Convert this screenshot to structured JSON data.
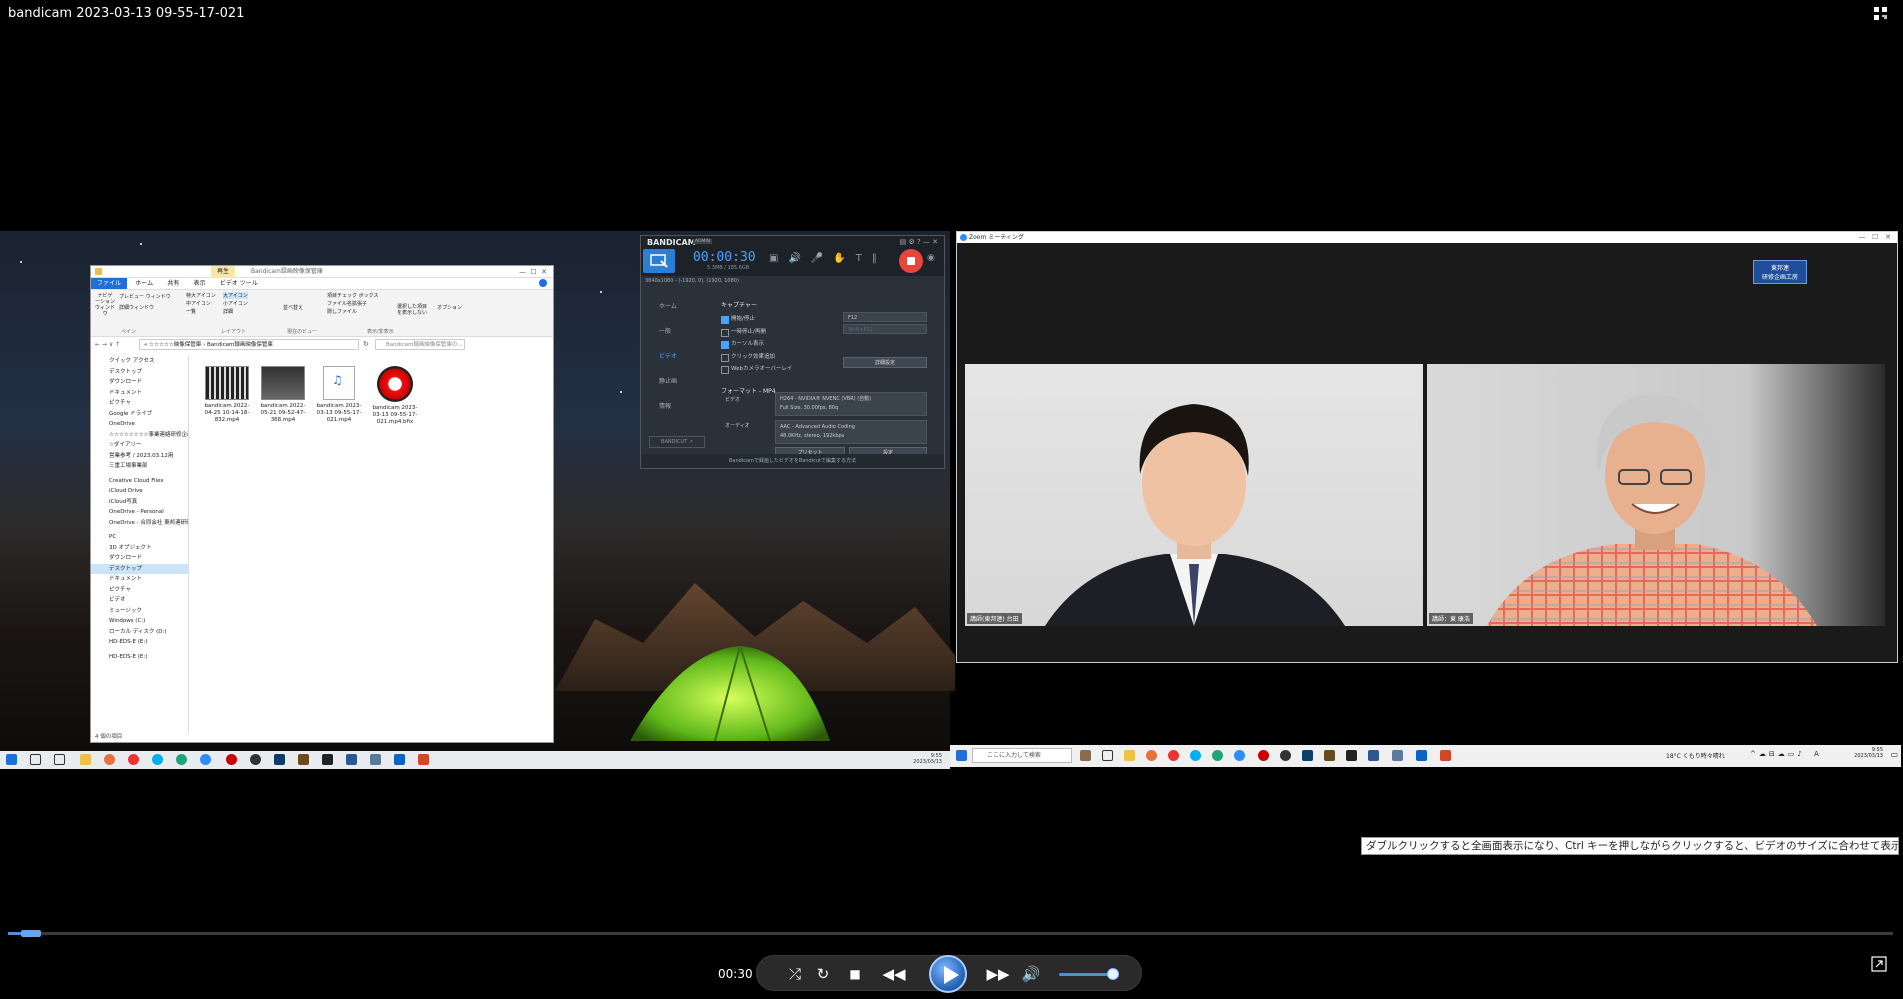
{
  "window": {
    "title": "bandicam 2023-03-13 09-55-17-021"
  },
  "player": {
    "current_time": "00:30",
    "progress_fraction": 0.012,
    "volume_fraction": 0.9,
    "tooltip": "ダブルクリックすると全画面表示になり、Ctrl キーを押しながらクリックすると、ビデオのサイズに合わせて表示されます。"
  },
  "explorer": {
    "title": "Bandicam録画映像保管庫",
    "context_tab": "再生",
    "ribbon_tabs": [
      "ファイル",
      "ホーム",
      "共有",
      "表示",
      "ビデオ ツール"
    ],
    "ribbon_groups": [
      "ペイン",
      "レイアウト",
      "現在のビュー",
      "表示/非表示"
    ],
    "ribbon_items": {
      "nav_pane": "ナビゲーション ウィンドウ",
      "preview_pane": "プレビュー ウィンドウ",
      "details_pane": "詳細ウィンドウ",
      "large_icons": "特大アイコン",
      "big_icons": "大アイコン",
      "medium_icons": "中アイコン",
      "small_icons": "小アイコン",
      "list": "一覧",
      "details": "詳細",
      "sort": "並べ替え",
      "item_checkbox": "項目チェック ボックス",
      "file_ext": "ファイル名拡張子",
      "hidden_files": "隠しファイル",
      "hide_selected": "選択した項目を表示しない",
      "options": "オプション"
    },
    "address": "« ☆☆☆☆☆映像保管庫 › Bandicam録画映像保管庫",
    "search_placeholder": "Bandicam録画映像保管庫の...",
    "nav_items": [
      "クイック アクセス",
      "デスクトップ",
      "ダウンロード",
      "ドキュメント",
      "ピクチャ",
      "Google ドライブ",
      "OneDrive",
      "☆☆☆☆☆☆☆☆事業連絡研修企画",
      "☆ダイアリー",
      "営業参考 / 2023.03.12用",
      "三重工場事業部"
    ],
    "nav_items2": [
      "Creative Cloud Files",
      "iCloud Drive",
      "iCloud写真",
      "OneDrive - Personal",
      "OneDrive - 合同会社 東邦連研研"
    ],
    "nav_items3": [
      "PC",
      "3D オブジェクト",
      "ダウンロード",
      "デスクトップ",
      "ドキュメント",
      "ピクチャ",
      "ビデオ",
      "ミュージック",
      "Windows (C:)",
      "ローカル ディスク (D:)",
      "HD-EDS-E (E:)"
    ],
    "nav_items4": [
      "HD-EDS-E (E:)"
    ],
    "files": [
      {
        "name": "bandicam 2022-04-25 10-14-18-832.mp4"
      },
      {
        "name": "bandicam 2022-05-21 09-52-47-368.mp4"
      },
      {
        "name": "bandicam 2023-03-13 09-55-17-021.mp4"
      },
      {
        "name": "bandicam 2023-03-13 09-55-17-021.mp4.bfix"
      }
    ],
    "status": "4 個の項目"
  },
  "bandicam": {
    "logo": "BANDICAM",
    "badge": "ADMIN",
    "timer": "00:00:30",
    "size": "5.3MB / 185.6GB",
    "resolution": "3840x1080 - (-1920, 0), (1920, 1080)",
    "sidebar": [
      "ホーム",
      "一般",
      "ビデオ",
      "静止画",
      "情報"
    ],
    "section_capture": "キャプチャー",
    "checks": [
      {
        "label": "開始/停止",
        "on": true
      },
      {
        "label": "一時停止/再開",
        "on": false
      },
      {
        "label": "カーソル表示",
        "on": true
      },
      {
        "label": "クリック効果追加",
        "on": false
      },
      {
        "label": "Webカメラオーバーレイ",
        "on": false
      }
    ],
    "hotkey": "F12",
    "hotkey2": "Shift+F12",
    "advanced_btn": "詳細設定",
    "section_format": "フォーマット - MP4",
    "video_label": "ビデオ",
    "video_value": "H264 - NVIDIA® NVENC (VBR) (自動)",
    "video_value2": "Full Size, 30.00fps, 80q",
    "audio_label": "オーディオ",
    "audio_value": "AAC - Advanced Audio Coding",
    "audio_value2": "48.0KHz, stereo, 192kbps",
    "preset_btn": "プリセット",
    "settings_btn": "設定",
    "bandicut": "BANDICUT ↗",
    "footer": "Bandicamで録画したビデオをBandicutで編集する方法"
  },
  "zoom": {
    "title": "Zoom ミーティング",
    "badge_line1": "東邦連",
    "badge_line2": "研修企画工房",
    "tile_left_label": "講師(東邦連) 台田",
    "tile_right_label": "講師：東 康浩"
  },
  "taskbar": {
    "search": "ここに入力して検索",
    "weather": "18°C くもり時々晴れ",
    "time_right": "9:55",
    "date_right": "2023/03/13",
    "time_left": "9:55",
    "date_left": "2023/03/13",
    "ime": "A"
  }
}
